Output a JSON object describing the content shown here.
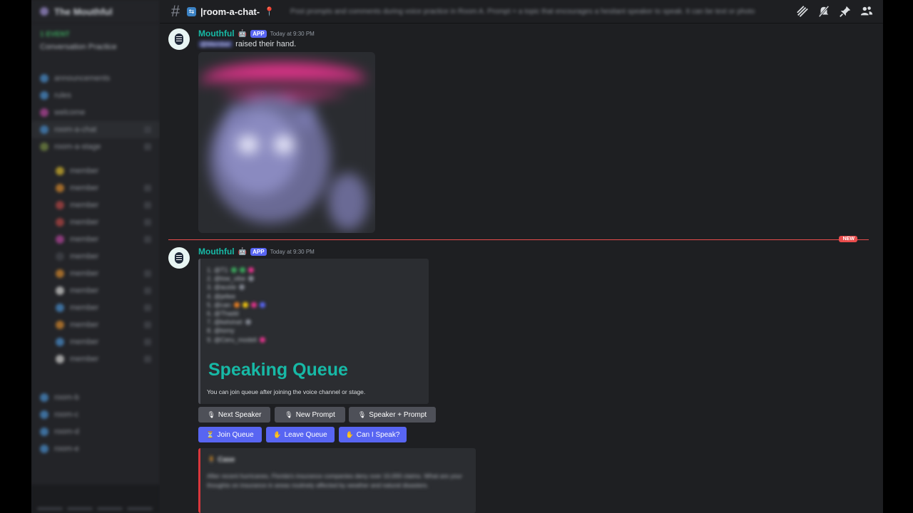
{
  "server": {
    "name": "The Mouthful"
  },
  "sidebar": {
    "event_label": "1 EVENT",
    "event_text": "Conversation Practice",
    "channels": [
      "announcements",
      "rules",
      "welcome",
      "roles",
      "room-a-chat",
      "room-a-stage"
    ],
    "members": [
      "member",
      "member",
      "member",
      "member",
      "member",
      "member",
      "member",
      "member",
      "member",
      "member",
      "member",
      "member"
    ],
    "lower_channels": [
      "room-b",
      "room-c",
      "room-d",
      "room-e"
    ]
  },
  "header": {
    "channel_name": "room-a-chat-",
    "channel_badge": "⇆",
    "channel_emoji": "📍",
    "topic": "Post prompts and comments during voice practice in Room A. Prompt = a topic that encourages a hesitant speaker to speak. It can be text or photo",
    "icons": [
      "threads-icon",
      "notifications-muted-icon",
      "pinned-icon",
      "members-icon"
    ]
  },
  "messages": [
    {
      "author": "Mouthful",
      "tag": "APP",
      "time": "Today at 9:30 PM",
      "mention": "@Member",
      "text": "raised their hand."
    },
    {
      "author": "Mouthful",
      "tag": "APP",
      "time": "Today at 9:30 PM",
      "queue_lines": [
        "1. @T1",
        "2. @low_vibe",
        "3. @auste",
        "4. @jellee",
        "5. @can",
        "6. @Thadd",
        "7. @kelvinet",
        "8. @tomy",
        "9. @Ceru_modeli"
      ],
      "embed_title": "Speaking Queue",
      "embed_desc": "You can join queue after joining the voice channel or stage.",
      "buttons_row1": [
        {
          "icon": "🎙",
          "label": "Next Speaker"
        },
        {
          "icon": "🎙",
          "label": "New Prompt"
        },
        {
          "icon": "🎙",
          "label": "Speaker + Prompt"
        }
      ],
      "buttons_row2": [
        {
          "icon": "⏳",
          "label": "Join Queue"
        },
        {
          "icon": "✋",
          "label": "Leave Queue"
        },
        {
          "icon": "✋",
          "label": "Can I Speak?"
        }
      ]
    }
  ],
  "new_divider": "NEW",
  "prompt_embed": {
    "title": "Case",
    "text": "After recent hurricanes, Florida's insurance companies deny over 10,000 claims. What are your thoughts on insurance in areas routinely affected by weather and natural disasters."
  }
}
